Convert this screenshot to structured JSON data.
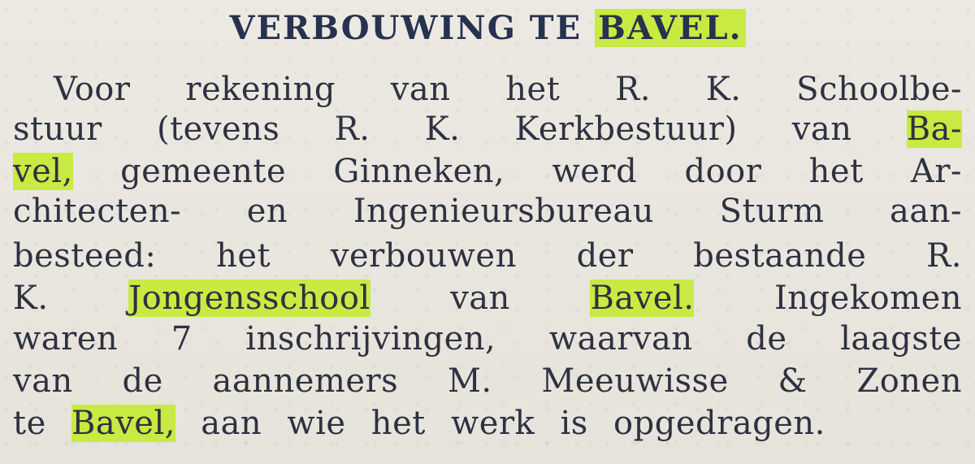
{
  "article": {
    "headline": {
      "prefix": "VERBOUWING TE ",
      "highlight": "BAVEL."
    },
    "lines": [
      {
        "before": "Voor rekening van het R. K. Schoolbe-",
        "highlight": "",
        "after": ""
      },
      {
        "before": "stuur (tevens R. K. Kerkbestuur) van ",
        "highlight": "Ba-",
        "after": ""
      },
      {
        "before": "",
        "highlight": "vel,",
        "after": " gemeente Ginneken, werd door het Ar-"
      },
      {
        "before": "chitecten- en Ingenieursbureau Sturm aan-",
        "highlight": "",
        "after": ""
      },
      {
        "before": "besteed: het verbouwen der bestaande R.",
        "highlight": "",
        "after": ""
      },
      {
        "before": "K. ",
        "highlight": "Jongensschool",
        "after": " van ",
        "highlight2": "Bavel.",
        "after2": " Ingekomen"
      },
      {
        "before": "waren 7 inschrijvingen, waarvan de laagste",
        "highlight": "",
        "after": ""
      },
      {
        "before": "van de aannemers M. Meeuwisse & Zonen",
        "highlight": "",
        "after": ""
      },
      {
        "before": "te ",
        "highlight": "Bavel,",
        "after": " aan wie het werk is opgedragen."
      }
    ]
  },
  "colors": {
    "paper": "#e9e6df",
    "ink": "#2e3140",
    "headline_ink": "#26324e",
    "highlight": "#c8ea43"
  }
}
